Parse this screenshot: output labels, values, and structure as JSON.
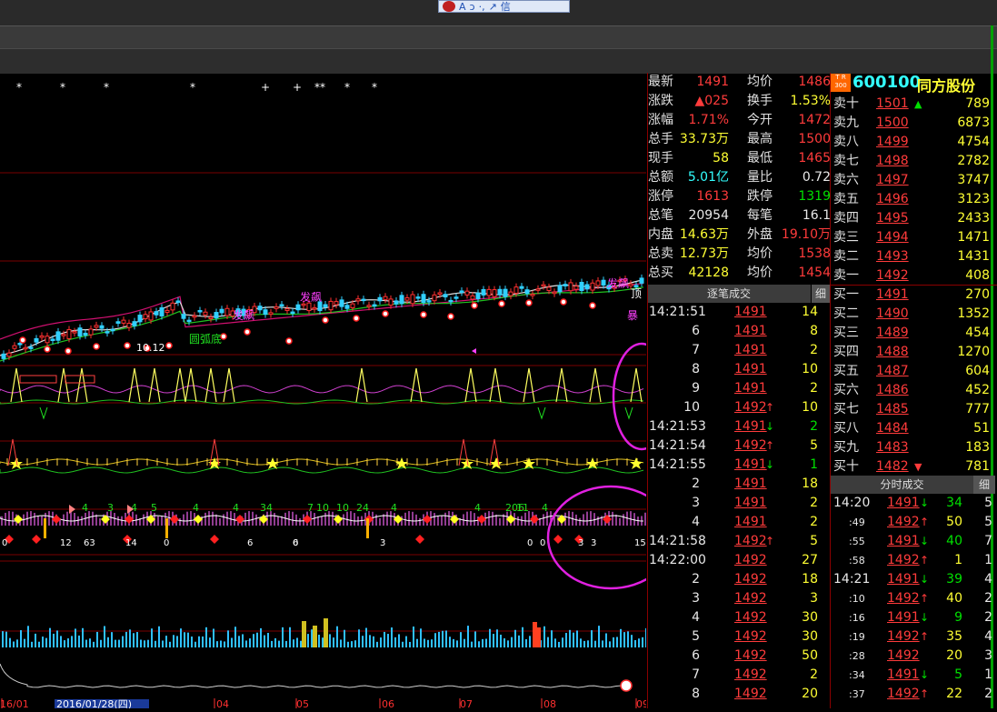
{
  "toolbar": {
    "items": [
      "A",
      "ↄ",
      "·,",
      "↗",
      "信"
    ]
  },
  "chart": {
    "markers": [
      "*",
      "*",
      "*",
      "*",
      "+",
      "+",
      "**",
      "*",
      "*"
    ],
    "labels": {
      "fapiao1": "发飙",
      "fapiao2": "发飙",
      "fapiao3": "发飙",
      "yuanhu": "圆弧底",
      "date_mark": "10.12",
      "bao": "暴",
      "ding": "顶"
    },
    "x_labels": [
      "16/01",
      "2016/01/28(四)",
      "04",
      "05",
      "06",
      "07",
      "08",
      "09"
    ],
    "strip_numbers": [
      "4",
      "3",
      "4",
      "5",
      "4",
      "4",
      "3",
      "4",
      "7",
      "10",
      "10",
      "24",
      "4",
      "4",
      "206",
      "11",
      "4"
    ],
    "strip_bottom_numbers": [
      "0",
      "12",
      "63",
      "14",
      "0",
      "6",
      "6",
      "0",
      "3",
      "0",
      "3",
      "3",
      "0",
      "15"
    ]
  },
  "stats": {
    "rows": [
      {
        "l1": "最新",
        "v1": "1491",
        "c1": "red",
        "l2": "均价",
        "v2": "1486",
        "c2": "red"
      },
      {
        "l1": "涨跌",
        "v1": "▲025",
        "c1": "red",
        "l2": "换手",
        "v2": "1.53%",
        "c2": "yellow"
      },
      {
        "l1": "涨幅",
        "v1": "1.71%",
        "c1": "red",
        "l2": "今开",
        "v2": "1472",
        "c2": "red"
      },
      {
        "l1": "总手",
        "v1": "33.73万",
        "c1": "yellow",
        "l2": "最高",
        "v2": "1500",
        "c2": "red"
      },
      {
        "l1": "现手",
        "v1": "58",
        "c1": "yellow",
        "l2": "最低",
        "v2": "1465",
        "c2": "red"
      },
      {
        "l1": "总额",
        "v1": "5.01亿",
        "c1": "cyan",
        "l2": "量比",
        "v2": "0.72",
        "c2": "white"
      },
      {
        "l1": "涨停",
        "v1": "1613",
        "c1": "red",
        "l2": "跌停",
        "v2": "1319",
        "c2": "green"
      },
      {
        "l1": "总笔",
        "v1": "20954",
        "c1": "white",
        "l2": "每笔",
        "v2": "16.1",
        "c2": "white"
      },
      {
        "l1": "内盘",
        "v1": "14.63万",
        "c1": "yellow",
        "l2": "外盘",
        "v2": "19.10万",
        "c2": "red"
      },
      {
        "l1": "总卖",
        "v1": "12.73万",
        "c1": "yellow",
        "l2": "均价",
        "v2": "1538",
        "c2": "red"
      },
      {
        "l1": "总买",
        "v1": "42128",
        "c1": "yellow",
        "l2": "均价",
        "v2": "1454",
        "c2": "red"
      }
    ]
  },
  "stock": {
    "badge": "T R 300",
    "code": "600100",
    "name": "同方股份"
  },
  "book": {
    "sell": [
      {
        "label": "卖十",
        "price": "1501",
        "arrow": "▲",
        "vol": "789"
      },
      {
        "label": "卖九",
        "price": "1500",
        "arrow": "",
        "vol": "6873"
      },
      {
        "label": "卖八",
        "price": "1499",
        "arrow": "",
        "vol": "4754"
      },
      {
        "label": "卖七",
        "price": "1498",
        "arrow": "",
        "vol": "2782"
      },
      {
        "label": "卖六",
        "price": "1497",
        "arrow": "",
        "vol": "3747"
      },
      {
        "label": "卖五",
        "price": "1496",
        "arrow": "",
        "vol": "3123"
      },
      {
        "label": "卖四",
        "price": "1495",
        "arrow": "",
        "vol": "2433"
      },
      {
        "label": "卖三",
        "price": "1494",
        "arrow": "",
        "vol": "1471"
      },
      {
        "label": "卖二",
        "price": "1493",
        "arrow": "",
        "vol": "1431"
      },
      {
        "label": "卖一",
        "price": "1492",
        "arrow": "",
        "vol": "408"
      }
    ],
    "buy": [
      {
        "label": "买一",
        "price": "1491",
        "arrow": "",
        "vol": "270"
      },
      {
        "label": "买二",
        "price": "1490",
        "arrow": "",
        "vol": "1352"
      },
      {
        "label": "买三",
        "price": "1489",
        "arrow": "",
        "vol": "454"
      },
      {
        "label": "买四",
        "price": "1488",
        "arrow": "",
        "vol": "1270"
      },
      {
        "label": "买五",
        "price": "1487",
        "arrow": "",
        "vol": "604"
      },
      {
        "label": "买六",
        "price": "1486",
        "arrow": "",
        "vol": "452"
      },
      {
        "label": "买七",
        "price": "1485",
        "arrow": "",
        "vol": "777"
      },
      {
        "label": "买八",
        "price": "1484",
        "arrow": "",
        "vol": "51"
      },
      {
        "label": "买九",
        "price": "1483",
        "arrow": "",
        "vol": "183"
      },
      {
        "label": "买十",
        "price": "1482",
        "arrow": "▼",
        "vol": "781"
      }
    ]
  },
  "trades_panel": {
    "title": "逐笔成交",
    "btn": "细",
    "rows": [
      {
        "t": "14:21:51",
        "p": "1491",
        "a": "",
        "v": "14"
      },
      {
        "t": "6",
        "p": "1491",
        "a": "",
        "v": "8"
      },
      {
        "t": "7",
        "p": "1491",
        "a": "",
        "v": "2"
      },
      {
        "t": "8",
        "p": "1491",
        "a": "",
        "v": "10"
      },
      {
        "t": "9",
        "p": "1491",
        "a": "",
        "v": "2"
      },
      {
        "t": "10",
        "p": "1492",
        "a": "up",
        "v": "10"
      },
      {
        "t": "14:21:53",
        "p": "1491",
        "a": "down",
        "v": "2"
      },
      {
        "t": "14:21:54",
        "p": "1492",
        "a": "up",
        "v": "5"
      },
      {
        "t": "14:21:55",
        "p": "1491",
        "a": "down",
        "v": "1"
      },
      {
        "t": "2",
        "p": "1491",
        "a": "",
        "v": "18"
      },
      {
        "t": "3",
        "p": "1491",
        "a": "",
        "v": "2"
      },
      {
        "t": "4",
        "p": "1491",
        "a": "",
        "v": "2"
      },
      {
        "t": "14:21:58",
        "p": "1492",
        "a": "up",
        "v": "5"
      },
      {
        "t": "14:22:00",
        "p": "1492",
        "a": "",
        "v": "27"
      },
      {
        "t": "2",
        "p": "1492",
        "a": "",
        "v": "18"
      },
      {
        "t": "3",
        "p": "1492",
        "a": "",
        "v": "3"
      },
      {
        "t": "4",
        "p": "1492",
        "a": "",
        "v": "30"
      },
      {
        "t": "5",
        "p": "1492",
        "a": "",
        "v": "30"
      },
      {
        "t": "6",
        "p": "1492",
        "a": "",
        "v": "50"
      },
      {
        "t": "7",
        "p": "1492",
        "a": "",
        "v": "2"
      },
      {
        "t": "8",
        "p": "1492",
        "a": "",
        "v": "20"
      }
    ]
  },
  "minute_panel": {
    "title": "分时成交",
    "btn": "细",
    "rows": [
      {
        "t": "14:20",
        "p": "1491",
        "a": "down",
        "v": "34",
        "n": "5"
      },
      {
        "t": ":49",
        "p": "1492",
        "a": "up",
        "v": "50",
        "n": "5"
      },
      {
        "t": ":55",
        "p": "1491",
        "a": "down",
        "v": "40",
        "n": "7"
      },
      {
        "t": ":58",
        "p": "1492",
        "a": "up",
        "v": "1",
        "n": "1"
      },
      {
        "t": "14:21",
        "p": "1491",
        "a": "down",
        "v": "39",
        "n": "4"
      },
      {
        "t": ":10",
        "p": "1492",
        "a": "up",
        "v": "40",
        "n": "2"
      },
      {
        "t": ":16",
        "p": "1491",
        "a": "down",
        "v": "9",
        "n": "2"
      },
      {
        "t": ":19",
        "p": "1492",
        "a": "up",
        "v": "35",
        "n": "4"
      },
      {
        "t": ":28",
        "p": "1492",
        "a": "",
        "v": "20",
        "n": "3"
      },
      {
        "t": ":34",
        "p": "1491",
        "a": "down",
        "v": "5",
        "n": "1"
      },
      {
        "t": ":37",
        "p": "1492",
        "a": "up",
        "v": "22",
        "n": "2"
      }
    ]
  }
}
